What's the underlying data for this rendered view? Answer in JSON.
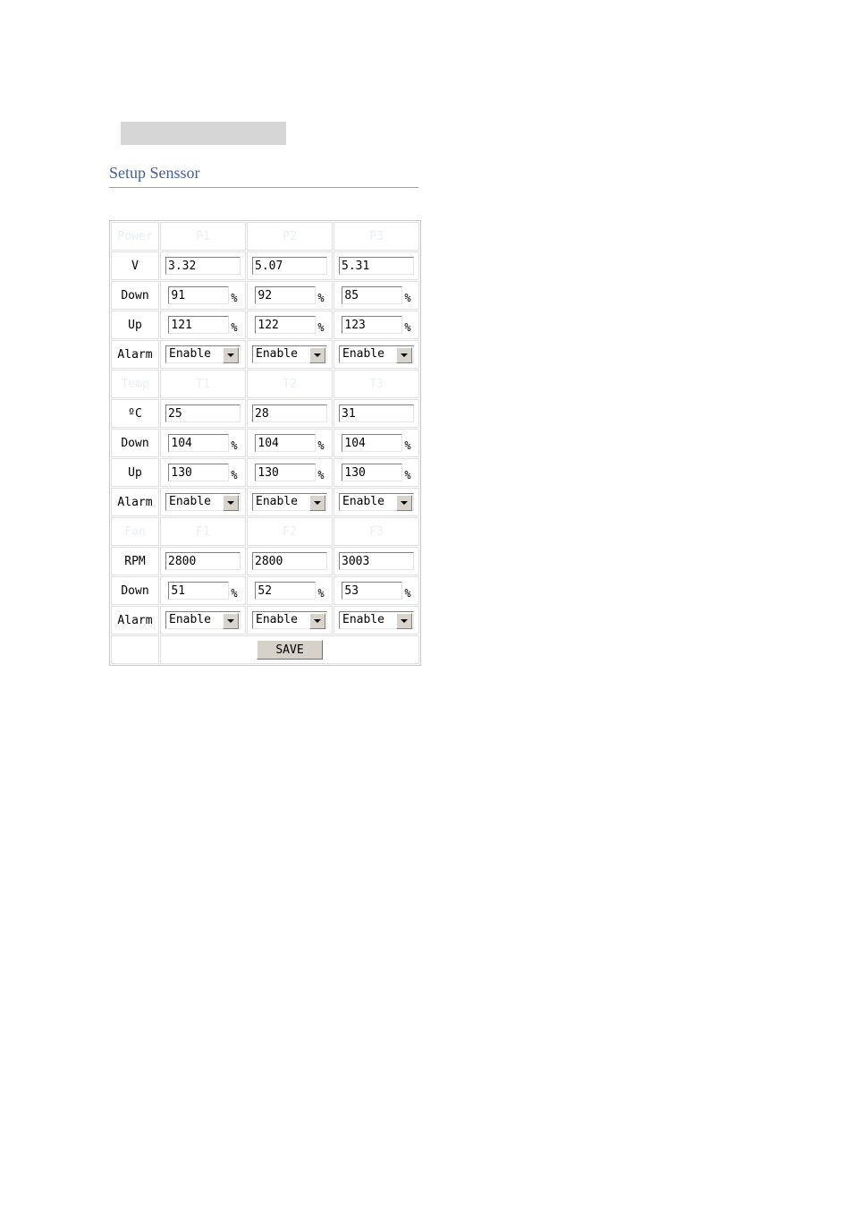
{
  "title": "Setup Senssor",
  "labels": {
    "power": "Power",
    "v": "V",
    "down": "Down",
    "up": "Up",
    "alarm": "Alarm",
    "temp": "Temp",
    "celsius": "ºC",
    "fan": "Fan",
    "rpm": "RPM",
    "percent": "%"
  },
  "headers": {
    "power": [
      "P1",
      "P2",
      "P3"
    ],
    "temp": [
      "T1",
      "T2",
      "T3"
    ],
    "fan": [
      "F1",
      "F2",
      "F3"
    ]
  },
  "power": {
    "v": [
      "3.32",
      "5.07",
      "5.31"
    ],
    "down": [
      "91",
      "92",
      "85"
    ],
    "up": [
      "121",
      "122",
      "123"
    ],
    "alarm": [
      "Enable",
      "Enable",
      "Enable"
    ]
  },
  "temp": {
    "c": [
      "25",
      "28",
      "31"
    ],
    "down": [
      "104",
      "104",
      "104"
    ],
    "up": [
      "130",
      "130",
      "130"
    ],
    "alarm": [
      "Enable",
      "Enable",
      "Enable"
    ]
  },
  "fan": {
    "rpm": [
      "2800",
      "2800",
      "3003"
    ],
    "down": [
      "51",
      "52",
      "53"
    ],
    "alarm": [
      "Enable",
      "Enable",
      "Enable"
    ]
  },
  "save": "SAVE"
}
